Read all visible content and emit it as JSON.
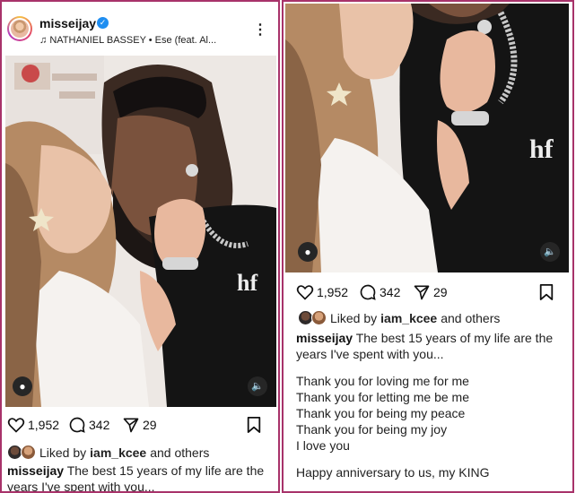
{
  "post": {
    "username": "misseijay",
    "song": "NATHANIEL BASSEY • Ese (feat. Al...",
    "like_count": "1,952",
    "comment_count": "342",
    "share_count": "29",
    "liked_by_prefix": "Liked by",
    "liked_by_user": "iam_kcee",
    "liked_by_suffix": "and others",
    "caption_first": "The best 15 years of my life are the",
    "caption_second": "years I've spent with you...",
    "caption_second_cut": "years I've spent with you...",
    "caption_lines": [
      "Thank you for loving me for me",
      "Thank you for letting me be me",
      "Thank you for being my peace",
      "Thank you for being my joy",
      "I love you"
    ],
    "caption_closing": "Happy anniversary to us, my KING"
  },
  "icons": {
    "verified": "verified-badge-icon",
    "music": "music-note-icon",
    "more": "more-options-icon",
    "like": "heart-icon",
    "comment": "comment-icon",
    "share": "share-icon",
    "save": "bookmark-icon",
    "tag": "user-tag-icon",
    "sound": "speaker-icon"
  },
  "colors": {
    "border": "#a8336a",
    "verified": "#1f8ef1"
  }
}
